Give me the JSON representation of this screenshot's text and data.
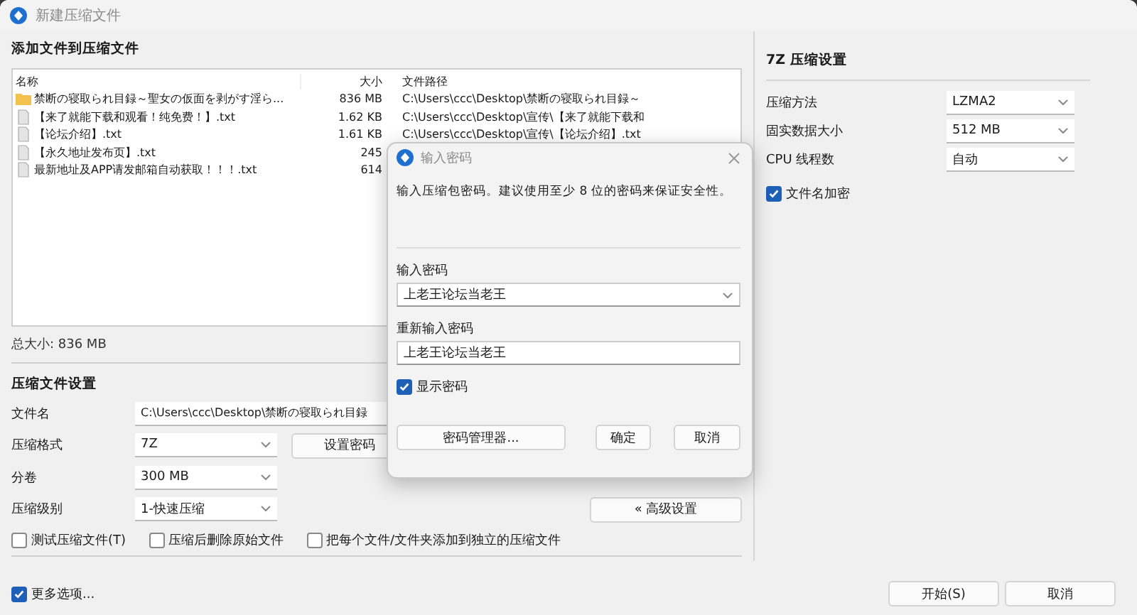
{
  "window": {
    "title": "新建压缩文件"
  },
  "files": {
    "heading": "添加文件到压缩文件",
    "columns": [
      "名称",
      "大小",
      "文件路径"
    ],
    "rows": [
      {
        "kind": "folder",
        "name": "禁断の寝取られ目録～聖女の仮面を剥がす淫ら...",
        "size": "836 MB",
        "path": "C:\\Users\\ccc\\Desktop\\禁断の寝取られ目録～"
      },
      {
        "kind": "file",
        "name": "【来了就能下载和观看！纯免费！】.txt",
        "size": "1.62 KB",
        "path": "C:\\Users\\ccc\\Desktop\\宣传\\【来了就能下载和"
      },
      {
        "kind": "file",
        "name": "【论坛介绍】.txt",
        "size": "1.61 KB",
        "path": "C:\\Users\\ccc\\Desktop\\宣传\\【论坛介绍】.txt"
      },
      {
        "kind": "file",
        "name": "【永久地址发布页】.txt",
        "size": "245"
      },
      {
        "kind": "file",
        "name": "最新地址及APP请发邮箱自动获取！！！.txt",
        "size": "614"
      }
    ],
    "total": "总大小: 836 MB"
  },
  "settings": {
    "heading": "压缩文件设置",
    "fields": [
      {
        "kind": "text",
        "label": "文件名",
        "value": "C:\\Users\\ccc\\Desktop\\禁断の寝取られ目録"
      },
      {
        "kind": "select",
        "label": "压缩格式",
        "value": "7Z"
      },
      {
        "kind": "select",
        "label": "分卷",
        "value": "300 MB"
      },
      {
        "kind": "select",
        "label": "压缩级别",
        "value": "1-快速压缩"
      }
    ],
    "password_button": "设置密码",
    "advanced_button": "« 高级设置",
    "options": [
      {
        "label": "测试压缩文件(T)",
        "checked": false
      },
      {
        "label": "压缩后删除原始文件",
        "checked": false
      },
      {
        "label": "把每个文件/文件夹添加到独立的压缩文件",
        "checked": false
      }
    ]
  },
  "more_options": {
    "label": "更多选项...",
    "checked": true
  },
  "buttons": [
    "开始(S)",
    "取消"
  ],
  "seven_zip": {
    "heading": "7Z 压缩设置",
    "fields": [
      {
        "label": "压缩方法",
        "value": "LZMA2"
      },
      {
        "label": "固实数据大小",
        "value": "512 MB"
      },
      {
        "label": "CPU 线程数",
        "value": "自动"
      }
    ],
    "encrypt_names": {
      "label": "文件名加密",
      "checked": true
    }
  },
  "dialog": {
    "title": "输入密码",
    "message": "输入压缩包密码。建议使用至少 8 位的密码来保证安全性。",
    "password_label": "输入密码",
    "password": "上老王论坛当老王",
    "confirm_label": "重新输入密码",
    "confirm": "上老王论坛当老王",
    "show_password": {
      "label": "显示密码",
      "checked": true
    },
    "manager_button": "密码管理器...",
    "buttons": [
      "确定",
      "取消"
    ]
  }
}
